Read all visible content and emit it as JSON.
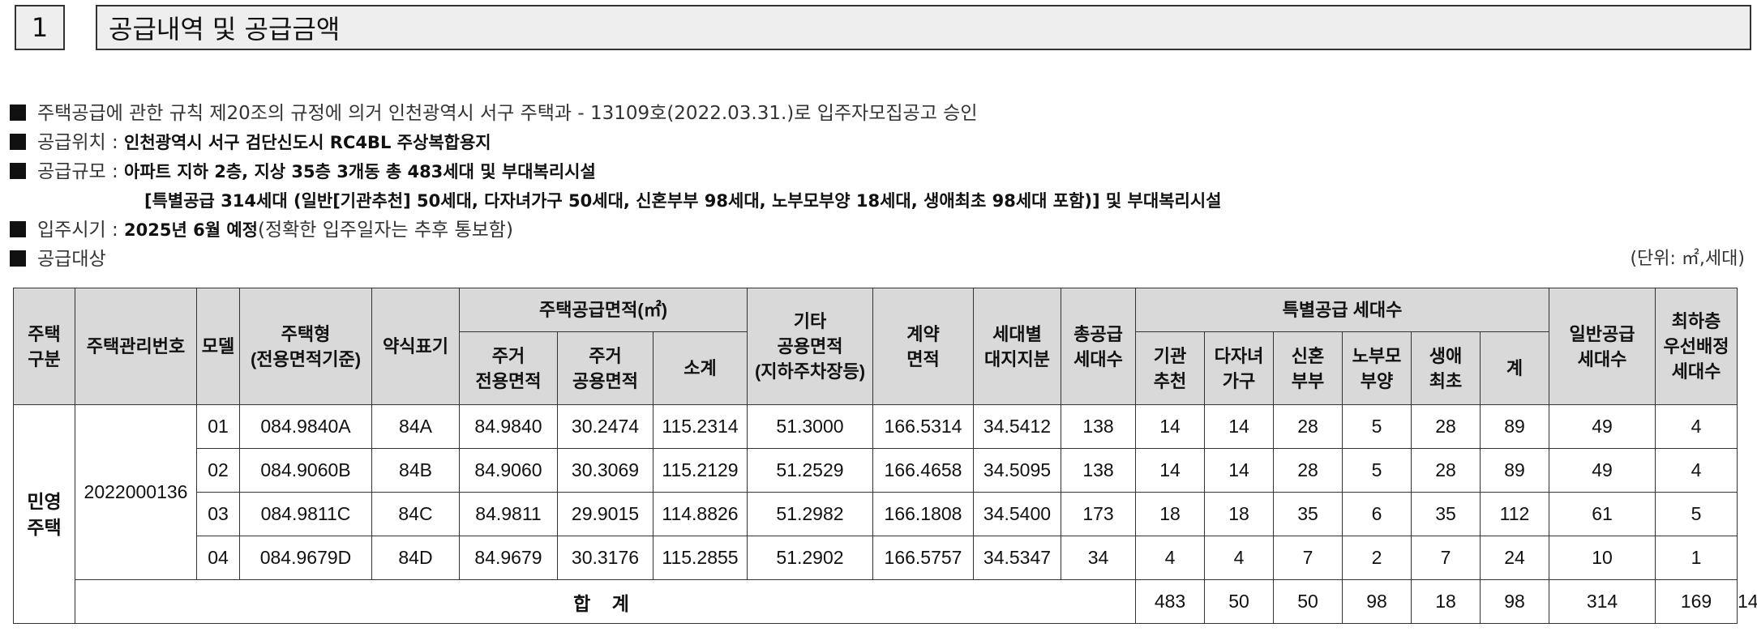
{
  "section": {
    "number": "1",
    "title": "공급내역 및 공급금액"
  },
  "info": {
    "approval": "주택공급에 관한 규칙 제20조의 규정에 의거 인천광역시 서구 주택과 - 13109호(2022.03.31.)로 입주자모집공고 승인",
    "location_label": "공급위치 :",
    "location_value": "인천광역시 서구 검단신도시 RC4BL 주상복합용지",
    "scale_label": "공급규모 :",
    "scale_value": "아파트 지하 2층, 지상 35층 3개동 총 483세대 및 부대복리시설",
    "scale_detail": "[특별공급 314세대 (일반[기관추천] 50세대, 다자녀가구 50세대, 신혼부부 98세대, 노부모부양 18세대, 생애최초 98세대 포함)] 및 부대복리시설",
    "movein_label": "입주시기 :",
    "movein_value": "2025년 6월 예정",
    "movein_note": "(정확한 입주일자는 추후 통보함)",
    "target_label": "공급대상",
    "unit": "(단위: ㎡,세대)"
  },
  "table": {
    "headers": {
      "housing_type": "주택\n구분",
      "mgmt_no": "주택관리번호",
      "model": "모델",
      "type": "주택형\n(전용면적기준)",
      "abbrev": "약식표기",
      "supply_area": "주택공급면적(㎡)",
      "exclusive": "주거\n전용면적",
      "common": "주거\n공용면적",
      "subtotal": "소계",
      "other_common": "기타\n공용면적\n(지하주차장등)",
      "contract": "계약\n면적",
      "land_share": "세대별\n대지지분",
      "total_units": "총공급\n세대수",
      "special": "특별공급 세대수",
      "sp_inst": "기관\n추천",
      "sp_multi": "다자녀\n가구",
      "sp_newlywed": "신혼\n부부",
      "sp_elder": "노부모\n부양",
      "sp_first": "생애\n최초",
      "sp_sum": "계",
      "general": "일반공급\n세대수",
      "lowest": "최하층\n우선배정\n세대수"
    },
    "housing_type": "민영\n주택",
    "mgmt_no": "2022000136",
    "rows": [
      [
        "01",
        "084.9840A",
        "84A",
        "84.9840",
        "30.2474",
        "115.2314",
        "51.3000",
        "166.5314",
        "34.5412",
        "138",
        "14",
        "14",
        "28",
        "5",
        "28",
        "89",
        "49",
        "4"
      ],
      [
        "02",
        "084.9060B",
        "84B",
        "84.9060",
        "30.3069",
        "115.2129",
        "51.2529",
        "166.4658",
        "34.5095",
        "138",
        "14",
        "14",
        "28",
        "5",
        "28",
        "89",
        "49",
        "4"
      ],
      [
        "03",
        "084.9811C",
        "84C",
        "84.9811",
        "29.9015",
        "114.8826",
        "51.2982",
        "166.1808",
        "34.5400",
        "173",
        "18",
        "18",
        "35",
        "6",
        "35",
        "112",
        "61",
        "5"
      ],
      [
        "04",
        "084.9679D",
        "84D",
        "84.9679",
        "30.3176",
        "115.2855",
        "51.2902",
        "166.5757",
        "34.5347",
        "34",
        "4",
        "4",
        "7",
        "2",
        "7",
        "24",
        "10",
        "1"
      ]
    ],
    "total": {
      "label": "합 계",
      "values": [
        "483",
        "50",
        "50",
        "98",
        "18",
        "98",
        "314",
        "169",
        "14"
      ]
    }
  }
}
